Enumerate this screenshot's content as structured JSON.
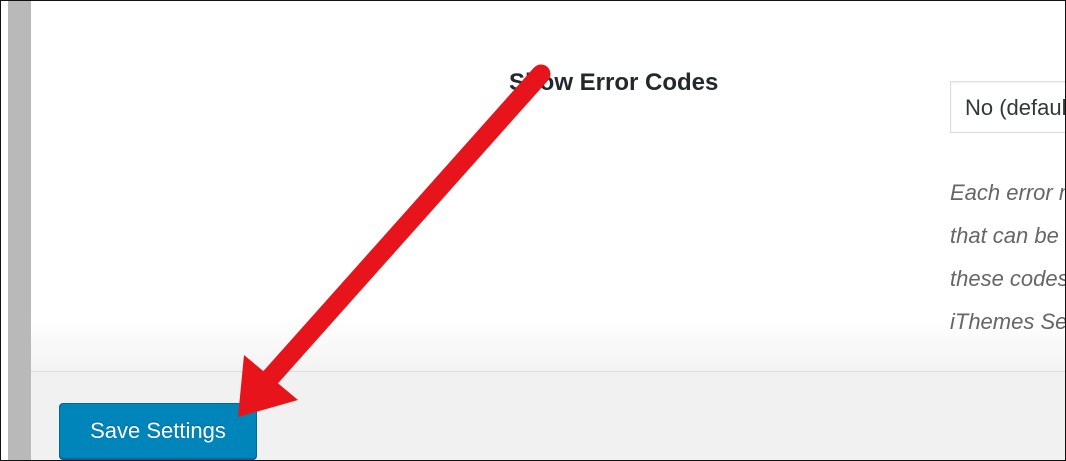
{
  "setting": {
    "label": "Show Error Codes",
    "select_value": "No (default)",
    "description_lines": [
      "Each error message",
      "that can be",
      "these codes",
      "iThemes Security"
    ]
  },
  "actions": {
    "save_label": "Save Settings"
  },
  "annotation": {
    "arrow_color": "#e8141b"
  },
  "colors": {
    "button_bg": "#0085ba",
    "footer_bg": "#f1f1f1",
    "rail_gray": "#b9b9b9"
  }
}
